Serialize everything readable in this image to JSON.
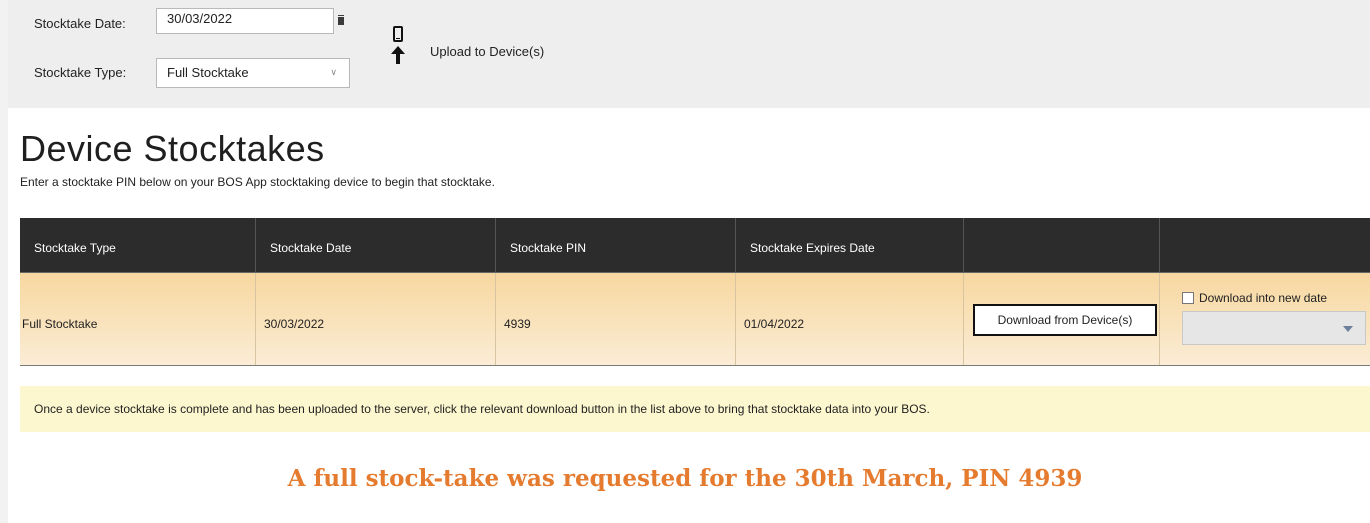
{
  "toolbar": {
    "stocktake_date_label": "Stocktake Date:",
    "stocktake_date_value": "30/03/2022",
    "stocktake_type_label": "Stocktake Type:",
    "stocktake_type_value": "Full Stocktake",
    "upload_label": "Upload to Device(s)"
  },
  "section": {
    "title": "Device Stocktakes",
    "subtitle": "Enter a stocktake PIN below on your BOS App stocktaking device to begin that stocktake."
  },
  "table": {
    "columns": [
      "Stocktake Type",
      "Stocktake Date",
      "Stocktake PIN",
      "Stocktake Expires Date",
      "",
      ""
    ],
    "rows": [
      {
        "type": "Full Stocktake",
        "date": "30/03/2022",
        "pin": "4939",
        "expires": "01/04/2022",
        "download_button": "Download from Device(s)",
        "new_date_checkbox_label": "Download into new date",
        "new_date_checked": false,
        "new_date_value": ""
      }
    ]
  },
  "info_message": "Once a device stocktake is complete and has been uploaded to the server, click the relevant download button in the list above to bring that stocktake data into your BOS.",
  "caption": "A full stock-take was requested for the 30th March, PIN 4939",
  "icons": {
    "calendar": "calendar-icon",
    "upload": "upload-to-device-icon",
    "dropdown": "chevron-down-icon"
  },
  "colors": {
    "toolbar_bg": "#eeeeee",
    "table_header_bg": "#2c2c2c",
    "row_highlight": "#f7d7a0",
    "info_bar_bg": "#fdf7cf",
    "caption_accent": "#e57b2f"
  }
}
